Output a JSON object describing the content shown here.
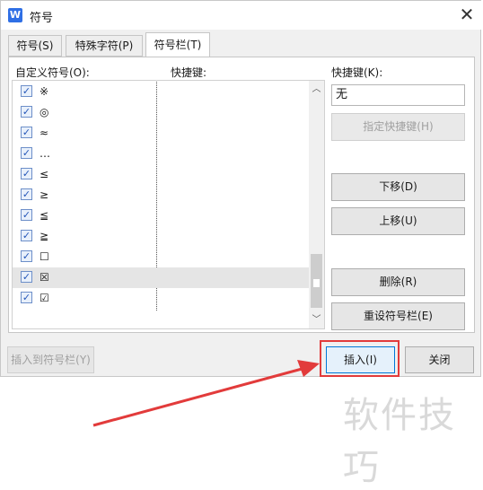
{
  "window": {
    "title": "符号",
    "app_icon": "W"
  },
  "tabs": [
    {
      "label": "符号(S)"
    },
    {
      "label": "特殊字符(P)"
    },
    {
      "label": "符号栏(T)"
    }
  ],
  "columns": {
    "custom_symbols": "自定义符号(O):",
    "shortcut": "快捷键:"
  },
  "symbols": [
    {
      "symbol": "※",
      "checked": true
    },
    {
      "symbol": "◎",
      "checked": true
    },
    {
      "symbol": "≈",
      "checked": true
    },
    {
      "symbol": "…",
      "checked": true
    },
    {
      "symbol": "≤",
      "checked": true
    },
    {
      "symbol": "≥",
      "checked": true
    },
    {
      "symbol": "≦",
      "checked": true
    },
    {
      "symbol": "≧",
      "checked": true
    },
    {
      "symbol": "☐",
      "checked": true
    },
    {
      "symbol": "☒",
      "checked": true
    },
    {
      "symbol": "☑",
      "checked": true
    }
  ],
  "right_panel": {
    "shortcut_label": "快捷键(K):",
    "shortcut_value": "无",
    "assign_shortcut": "指定快捷键(H)",
    "move_down": "下移(D)",
    "move_up": "上移(U)",
    "delete": "删除(R)",
    "reset": "重设符号栏(E)"
  },
  "bottom": {
    "insert_to_bar": "插入到符号栏(Y)",
    "insert": "插入(I)",
    "close": "关闭"
  },
  "watermark": "软件技巧",
  "annotation_color": "#e23b3b"
}
